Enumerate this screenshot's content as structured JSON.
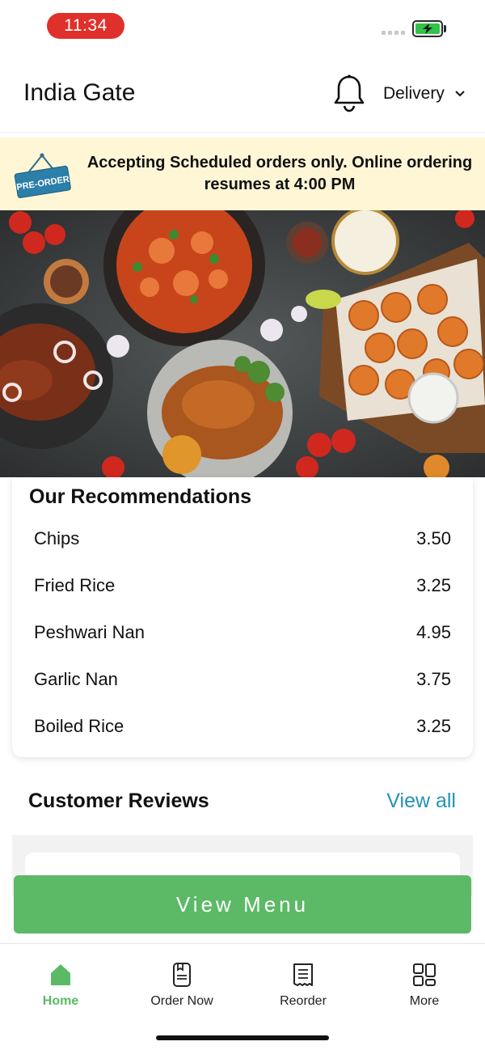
{
  "status_bar": {
    "time": "11:34"
  },
  "header": {
    "store_name": "India Gate",
    "delivery_label": "Delivery"
  },
  "banner": {
    "sign_text": "PRE-ORDER",
    "message": "Accepting Scheduled orders only. Online ordering resumes at 4:00 PM"
  },
  "recommendations": {
    "title": "Our Recommendations",
    "items": [
      {
        "name": "Chips",
        "price": "3.50"
      },
      {
        "name": "Fried Rice",
        "price": "3.25"
      },
      {
        "name": "Peshwari Nan",
        "price": "4.95"
      },
      {
        "name": "Garlic Nan",
        "price": "3.75"
      },
      {
        "name": "Boiled Rice",
        "price": "3.25"
      }
    ]
  },
  "reviews": {
    "title": "Customer Reviews",
    "view_all_label": "View all"
  },
  "view_menu_label": "View Menu",
  "tabs": [
    {
      "label": "Home",
      "icon": "home-icon",
      "active": true
    },
    {
      "label": "Order Now",
      "icon": "phone-order-icon",
      "active": false
    },
    {
      "label": "Reorder",
      "icon": "receipt-icon",
      "active": false
    },
    {
      "label": "More",
      "icon": "grid-icon",
      "active": false
    }
  ],
  "colors": {
    "accent_green": "#5cb966",
    "link_blue": "#2591b8",
    "banner_bg": "#fff6d6",
    "time_pill_red": "#e0302b"
  }
}
